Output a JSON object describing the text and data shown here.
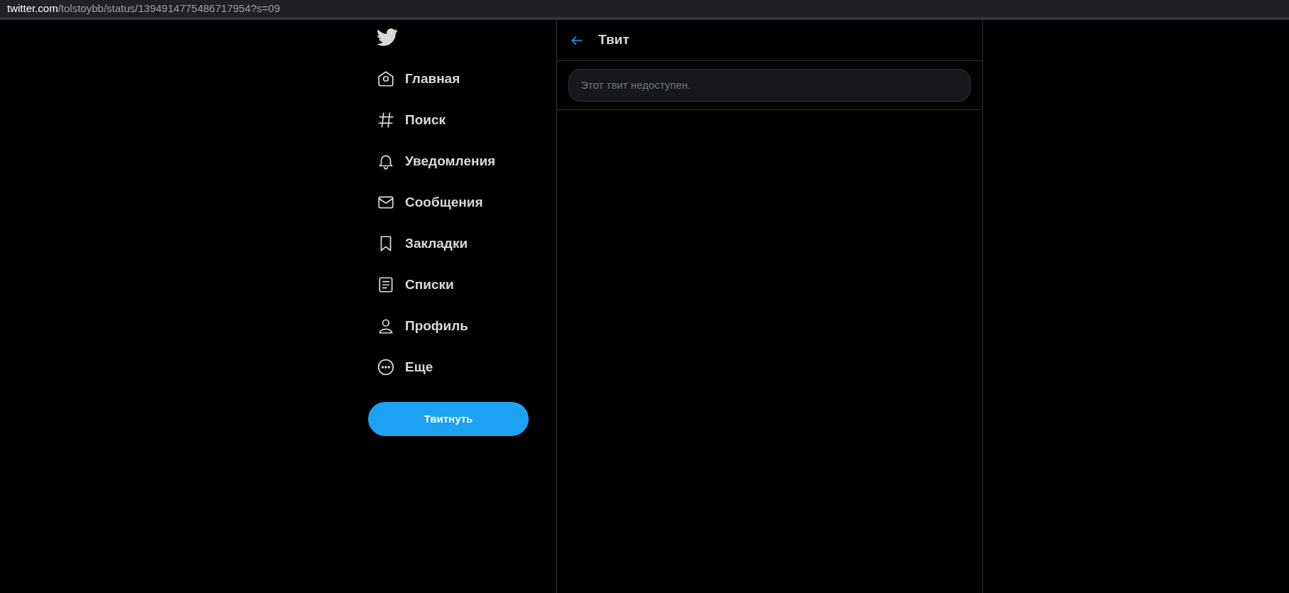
{
  "address_bar": {
    "host": "twitter.com",
    "path": "/tolstoybb/status/1394914775486717954?s=09"
  },
  "sidebar": {
    "items": [
      {
        "kind": "home",
        "label": "Главная"
      },
      {
        "kind": "hashtag",
        "label": "Поиск"
      },
      {
        "kind": "bell",
        "label": "Уведомления"
      },
      {
        "kind": "envelope",
        "label": "Сообщения"
      },
      {
        "kind": "bookmark",
        "label": "Закладки"
      },
      {
        "kind": "list",
        "label": "Списки"
      },
      {
        "kind": "person",
        "label": "Профиль"
      },
      {
        "kind": "more",
        "label": "Еще"
      }
    ],
    "tweet_button": "Твитнуть"
  },
  "header": {
    "title": "Твит"
  },
  "notice": "Этот твит недоступен."
}
